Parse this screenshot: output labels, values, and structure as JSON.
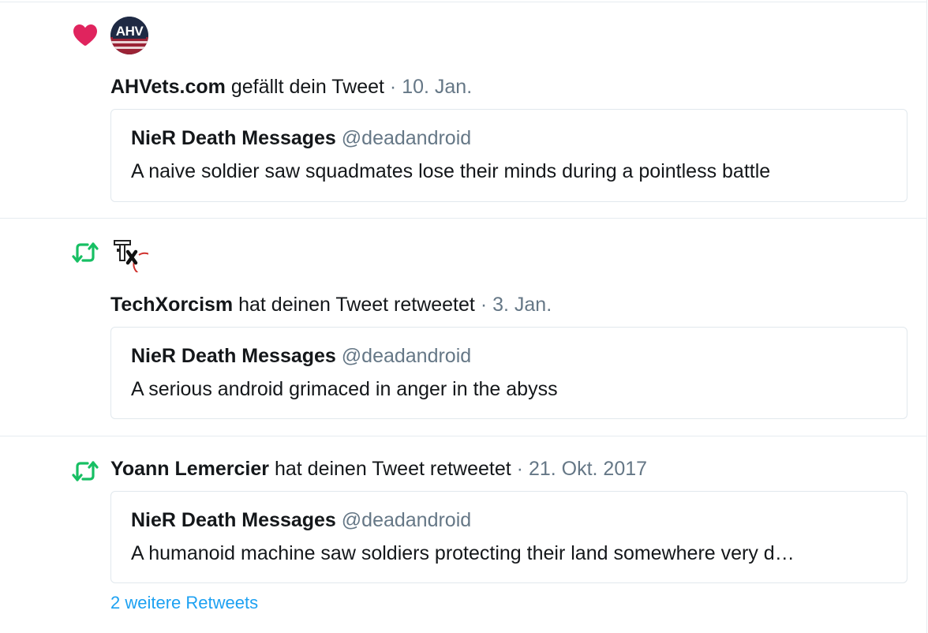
{
  "colors": {
    "like": "#e0245e",
    "retweet": "#17bf63",
    "link": "#1da1f2",
    "muted": "#657786"
  },
  "notifications": [
    {
      "type": "like",
      "icon": "heart-icon",
      "avatar_text": "AHV",
      "user": "AHVets.com",
      "action": "gefällt dein Tweet",
      "separator": "·",
      "date": "10. Jan.",
      "tweet": {
        "author": "NieR Death Messages",
        "handle": "@deadandroid",
        "text": "A naive soldier saw squadmates lose their minds during a pointless battle"
      }
    },
    {
      "type": "retweet",
      "icon": "retweet-icon",
      "avatar_text": "TX",
      "user": "TechXorcism",
      "action": "hat deinen Tweet retweetet",
      "separator": "·",
      "date": "3. Jan.",
      "tweet": {
        "author": "NieR Death Messages",
        "handle": "@deadandroid",
        "text": "A serious android grimaced in anger in the abyss"
      }
    },
    {
      "type": "retweet",
      "icon": "retweet-icon",
      "user": "Yoann Lemercier",
      "action": "hat deinen Tweet retweetet",
      "separator": "·",
      "date": "21. Okt. 2017",
      "tweet": {
        "author": "NieR Death Messages",
        "handle": "@deadandroid",
        "text": "A humanoid machine saw soldiers protecting their land somewhere very d…"
      }
    }
  ],
  "more_retweets": "2 weitere Retweets"
}
